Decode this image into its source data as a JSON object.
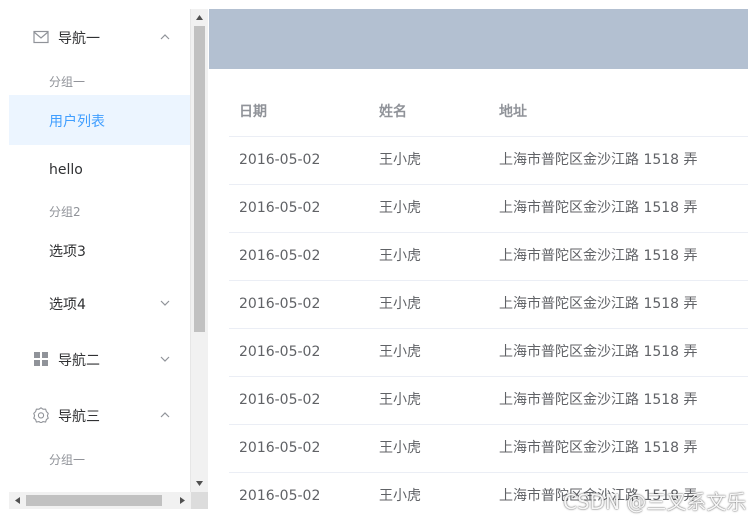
{
  "sidebar": {
    "nav1": {
      "label": "导航一",
      "icon": "mail-icon",
      "chevron": "chevron-up-icon"
    },
    "group1": {
      "label": "分组一"
    },
    "user_list": {
      "label": "用户列表"
    },
    "hello": {
      "label": "hello"
    },
    "group2": {
      "label": "分组2"
    },
    "option3": {
      "label": "选项3"
    },
    "option4": {
      "label": "选项4",
      "chevron": "chevron-down-icon"
    },
    "nav2": {
      "label": "导航二",
      "icon": "grid-icon",
      "chevron": "chevron-down-icon"
    },
    "nav3": {
      "label": "导航三",
      "icon": "gear-icon",
      "chevron": "chevron-up-icon"
    },
    "group1b": {
      "label": "分组一"
    }
  },
  "header": {
    "background": "#b3c0d1"
  },
  "table": {
    "columns": [
      "日期",
      "姓名",
      "地址"
    ],
    "rows": [
      [
        "2016-05-02",
        "王小虎",
        "上海市普陀区金沙江路 1518 弄"
      ],
      [
        "2016-05-02",
        "王小虎",
        "上海市普陀区金沙江路 1518 弄"
      ],
      [
        "2016-05-02",
        "王小虎",
        "上海市普陀区金沙江路 1518 弄"
      ],
      [
        "2016-05-02",
        "王小虎",
        "上海市普陀区金沙江路 1518 弄"
      ],
      [
        "2016-05-02",
        "王小虎",
        "上海市普陀区金沙江路 1518 弄"
      ],
      [
        "2016-05-02",
        "王小虎",
        "上海市普陀区金沙江路 1518 弄"
      ],
      [
        "2016-05-02",
        "王小虎",
        "上海市普陀区金沙江路 1518 弄"
      ],
      [
        "2016-05-02",
        "王小虎",
        "上海市普陀区金沙江路 1518 弄"
      ]
    ]
  },
  "watermark": {
    "text": "CSDN @三叉系文乐"
  },
  "colors": {
    "accent": "#409eff",
    "active_bg": "#ecf5ff",
    "header": "#b3c0d1"
  }
}
